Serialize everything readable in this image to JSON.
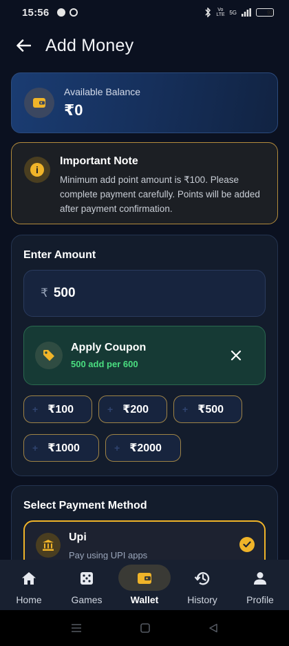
{
  "status": {
    "time": "15:56",
    "network_labels": [
      "Vo LTE",
      "5G"
    ],
    "battery": "92",
    "battery_level": 0.92
  },
  "header": {
    "title": "Add Money",
    "back_icon": "arrow-left-icon"
  },
  "balance": {
    "label": "Available Balance",
    "value": "₹0",
    "icon": "wallet-icon"
  },
  "note": {
    "title": "Important Note",
    "body": "Minimum add point amount is ₹100. Please complete payment carefully. Points will be added after payment confirmation.",
    "icon": "info-icon"
  },
  "amount": {
    "section_title": "Enter Amount",
    "currency_symbol": "₹",
    "value": "500"
  },
  "coupon": {
    "title": "Apply Coupon",
    "subtitle": "500 add per 600",
    "icon": "tag-icon",
    "close_icon": "close-icon"
  },
  "quick_amounts": [
    {
      "plus": "+",
      "label": "₹100"
    },
    {
      "plus": "+",
      "label": "₹200"
    },
    {
      "plus": "+",
      "label": "₹500"
    },
    {
      "plus": "+",
      "label": "₹1000"
    },
    {
      "plus": "+",
      "label": "₹2000"
    }
  ],
  "payment": {
    "section_title": "Select Payment Method",
    "option_title": "Upi",
    "option_subtitle": "Pay using UPI apps",
    "icon": "bank-icon",
    "selected": true
  },
  "nav": [
    {
      "label": "Home",
      "icon": "home-icon",
      "active": false
    },
    {
      "label": "Games",
      "icon": "dice-icon",
      "active": false
    },
    {
      "label": "Wallet",
      "icon": "wallet-icon",
      "active": true
    },
    {
      "label": "History",
      "icon": "history-icon",
      "active": false
    },
    {
      "label": "Profile",
      "icon": "profile-icon",
      "active": false
    }
  ],
  "colors": {
    "background": "#0b1120",
    "accent_gold": "#f0b429",
    "coupon_green": "#4ade80",
    "card_blue": "#1a3c72"
  }
}
